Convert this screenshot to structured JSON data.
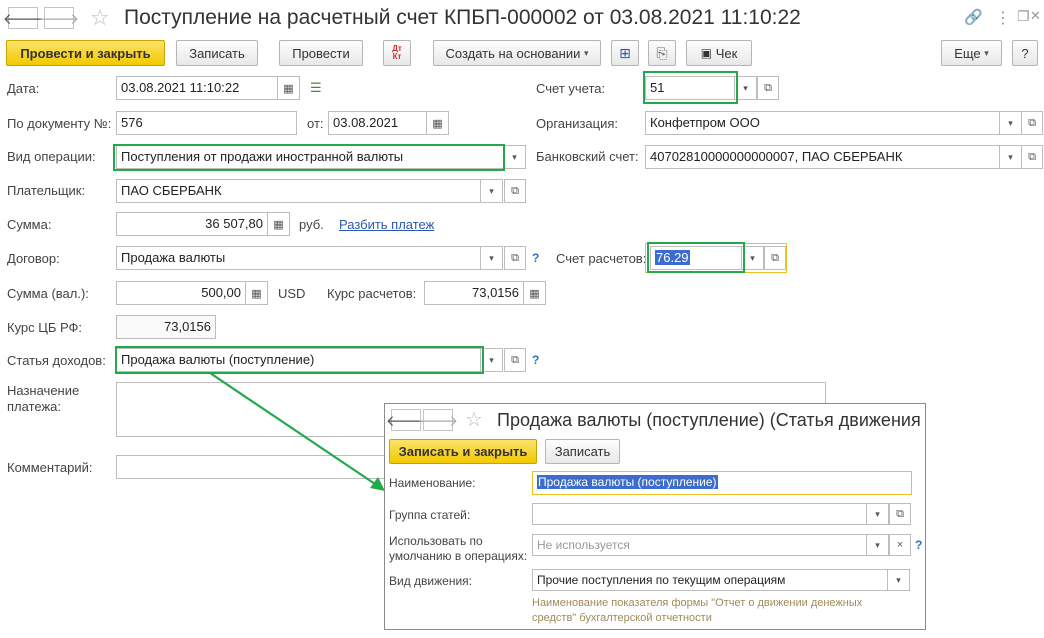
{
  "window": {
    "title": "Поступление на расчетный счет КПБП-000002 от 03.08.2021 11:10:22",
    "controls": {
      "link": "🔗",
      "menu": "⋮",
      "restore": "❐",
      "close": "✕"
    }
  },
  "toolbar": {
    "post_close": "Провести и закрыть",
    "save": "Записать",
    "post": "Провести",
    "dt_kt": "Дт\nКт",
    "create_based": "Создать на основании",
    "receipt": "Чек",
    "more": "Еще",
    "help": "?"
  },
  "form": {
    "date_label": "Дата:",
    "date_value": "03.08.2021 11:10:22",
    "doc_no_label": "По документу №:",
    "doc_no_value": "576",
    "from_label": "от:",
    "from_value": "03.08.2021",
    "operation_label": "Вид операции:",
    "operation_value": "Поступления от продажи иностранной валюты",
    "payer_label": "Плательщик:",
    "payer_value": "ПАО СБЕРБАНК",
    "sum_label": "Сумма:",
    "sum_value": "36 507,80",
    "currency_rub": "руб.",
    "split_payment": "Разбить платеж",
    "contract_label": "Договор:",
    "contract_value": "Продажа валюты",
    "sum_cur_label": "Сумма (вал.):",
    "sum_cur_value": "500,00",
    "currency_usd": "USD",
    "calc_rate_label": "Курс расчетов:",
    "calc_rate_value": "73,0156",
    "cb_rate_label": "Курс ЦБ РФ:",
    "cb_rate_value": "73,0156",
    "income_item_label": "Статья доходов:",
    "income_item_value": "Продажа валюты (поступление)",
    "purpose_label_1": "Назначение",
    "purpose_label_2": "платежа:",
    "comment_label": "Комментарий:",
    "account_label": "Счет учета:",
    "account_value": "51",
    "org_label": "Организация:",
    "org_value": "Конфетпром ООО",
    "bank_label": "Банковский счет:",
    "bank_value": "40702810000000000007, ПАО СБЕРБАНК",
    "settle_label": "Счет расчетов:",
    "settle_value": "76.29",
    "q": "?"
  },
  "popup": {
    "title": "Продажа валюты (поступление) (Статья движения де",
    "save_close": "Записать и закрыть",
    "save": "Записать",
    "name_label": "Наименование:",
    "name_value": "Продажа валюты (поступление)",
    "group_label": "Группа статей:",
    "group_value": "",
    "default_label_1": "Использовать по",
    "default_label_2": "умолчанию в операциях:",
    "default_placeholder": "Не используется",
    "movement_label": "Вид движения:",
    "movement_value": "Прочие поступления по текущим операциям",
    "hint_1": "Наименование показателя формы \"Отчет о движении денежных",
    "hint_2": "средств\" бухгалтерской отчетности"
  },
  "colors": {
    "accent_green": "#23a84a",
    "focus_orange": "#f0c020",
    "selection": "#3d6dcc",
    "primary_button": "#f2c900"
  }
}
